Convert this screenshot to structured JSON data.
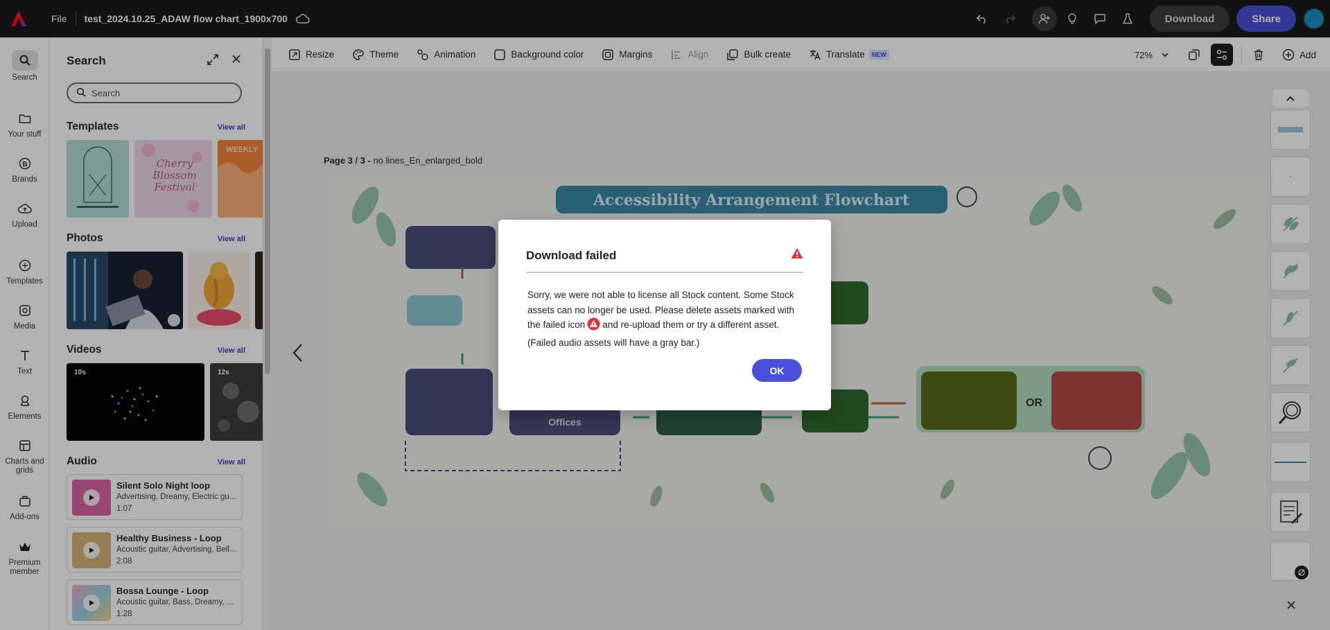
{
  "topbar": {
    "file_label": "File",
    "doc_title": "test_2024.10.25_ADAW flow chart_1900x700",
    "download_label": "Download",
    "share_label": "Share",
    "brand_color": "#fa0f00",
    "share_color": "#4a4fd6"
  },
  "rail": {
    "items": [
      {
        "label": "Search",
        "icon": "search-icon"
      },
      {
        "label": "Your stuff",
        "icon": "folder-icon"
      },
      {
        "label": "Brands",
        "icon": "brands-icon"
      },
      {
        "label": "Upload",
        "icon": "upload-icon"
      },
      {
        "label": "Templates",
        "icon": "templates-icon"
      },
      {
        "label": "Media",
        "icon": "media-icon"
      },
      {
        "label": "Text",
        "icon": "text-icon"
      },
      {
        "label": "Elements",
        "icon": "elements-icon"
      },
      {
        "label": "Charts and grids",
        "icon": "charts-icon"
      },
      {
        "label": "Add-ons",
        "icon": "addons-icon"
      },
      {
        "label": "Premium member",
        "icon": "premium-crown-icon"
      }
    ]
  },
  "panel": {
    "title": "Search",
    "search_placeholder": "Search",
    "view_all": "View all",
    "sections": {
      "templates": "Templates",
      "photos": "Photos",
      "videos": "Videos",
      "audio": "Audio"
    },
    "template_thumbs": {
      "t2_text": "Cherry Blossom Festival",
      "t3_text": "WEEKLY"
    },
    "video_thumbs": [
      {
        "duration": "10s"
      },
      {
        "duration": "12s"
      }
    ],
    "audio_items": [
      {
        "title": "Silent Solo Night loop",
        "tags": "Advertising, Dreamy, Electric guit...",
        "duration": "1:07"
      },
      {
        "title": "Healthy Business - Loop",
        "tags": "Acoustic guitar, Advertising, Bell, ...",
        "duration": "2:08"
      },
      {
        "title": "Bossa Lounge - Loop",
        "tags": "Acoustic guitar, Bass, Dreamy, Exo...",
        "duration": "1:28"
      }
    ]
  },
  "toolbar": {
    "resize": "Resize",
    "theme": "Theme",
    "animation": "Animation",
    "background_color": "Background color",
    "margins": "Margins",
    "align": "Align",
    "bulk_create": "Bulk create",
    "translate": "Translate",
    "new_badge": "NEW",
    "zoom": "72%",
    "add": "Add"
  },
  "canvas": {
    "page_label_prefix": "Page 3 / 3 -",
    "page_label_name": " no lines_En_enlarged_bold",
    "art_title": "Accessibility Arrangement Flowchart",
    "node_offices": "Offices",
    "node_or": "OR"
  },
  "dialog": {
    "title": "Download failed",
    "body_part1": "Sorry, we were not able to license all Stock content. Some Stock assets can no longer be used. Please delete assets marked with the failed icon",
    "body_part2": "and re-upload them or try a different asset. (Failed audio assets will have a gray bar.)",
    "ok_label": "OK",
    "warn_color": "#d7373f"
  }
}
